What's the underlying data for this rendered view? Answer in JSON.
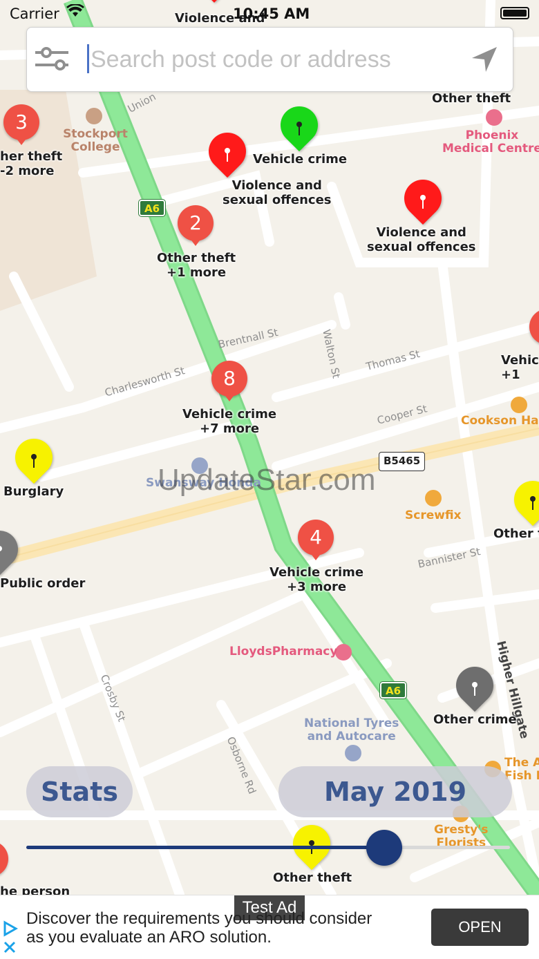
{
  "status_bar": {
    "carrier": "Carrier",
    "time": "10:45 AM"
  },
  "search": {
    "placeholder": "Search post code or address"
  },
  "map": {
    "pois": {
      "college": "Stockport\nCollege",
      "phoenix": "Phoenix\nMedical Centre",
      "cookson": "Cookson Har",
      "screwfix": "Screwfix",
      "swansway": "Swansway Honda",
      "lloyds": "LloydsPharmacy",
      "national": "National Tyres\nand Autocare",
      "thea": "The A\nFish B",
      "gresty": "Gresty's\nFlorists"
    },
    "streets": {
      "brentnall": "Brentnall St",
      "charlesworth": "Charlesworth St",
      "walton": "Walton St",
      "thomas": "Thomas St",
      "cooper": "Cooper St",
      "bannister": "Bannister St",
      "crosby": "Crosby St",
      "osborne": "Osborne Rd",
      "higher": "Higher Hillgate",
      "union": "Union"
    },
    "road_shields": {
      "a6_top": "A6",
      "a6_bottom": "A6",
      "b5465": "B5465"
    },
    "markers": [
      {
        "label": "Violence and",
        "color": "#ff1a1a"
      },
      {
        "label": "Other theft",
        "color": "#ffffff"
      },
      {
        "label": "Vehicle crime",
        "color": "#19d719"
      },
      {
        "label": "Violence and\nsexual offences",
        "color": "#ff1a1a"
      },
      {
        "label": "Violence and\nsexual offences",
        "color": "#ff1a1a"
      },
      {
        "label": "Burglary",
        "color": "#f7f200"
      },
      {
        "label": "Public order",
        "color": "#7a7a7a"
      },
      {
        "label": "Other crime",
        "color": "#6e6e6e"
      },
      {
        "label": "Other theft",
        "color": "#f7f200"
      },
      {
        "label": "Other t",
        "color": "#f7f200"
      },
      {
        "label": "Vehic\n+1",
        "color": "#ef5145"
      },
      {
        "label": "he person",
        "color": "#ef5145"
      }
    ],
    "clusters": [
      {
        "count": "3",
        "label": "her theft\n-2 more"
      },
      {
        "count": "2",
        "label": "Other theft\n+1 more"
      },
      {
        "count": "8",
        "label": "Vehicle crime\n+7 more"
      },
      {
        "count": "4",
        "label": "Vehicle crime\n+3 more"
      }
    ]
  },
  "controls": {
    "stats_label": "Stats",
    "month_label": "May 2019",
    "slider_value": 0.74
  },
  "watermark": "UpdateStar.com",
  "ad": {
    "badge": "Test Ad",
    "text": "Discover the requirements you should consider\nas you evaluate an ARO solution.",
    "cta": "OPEN"
  }
}
